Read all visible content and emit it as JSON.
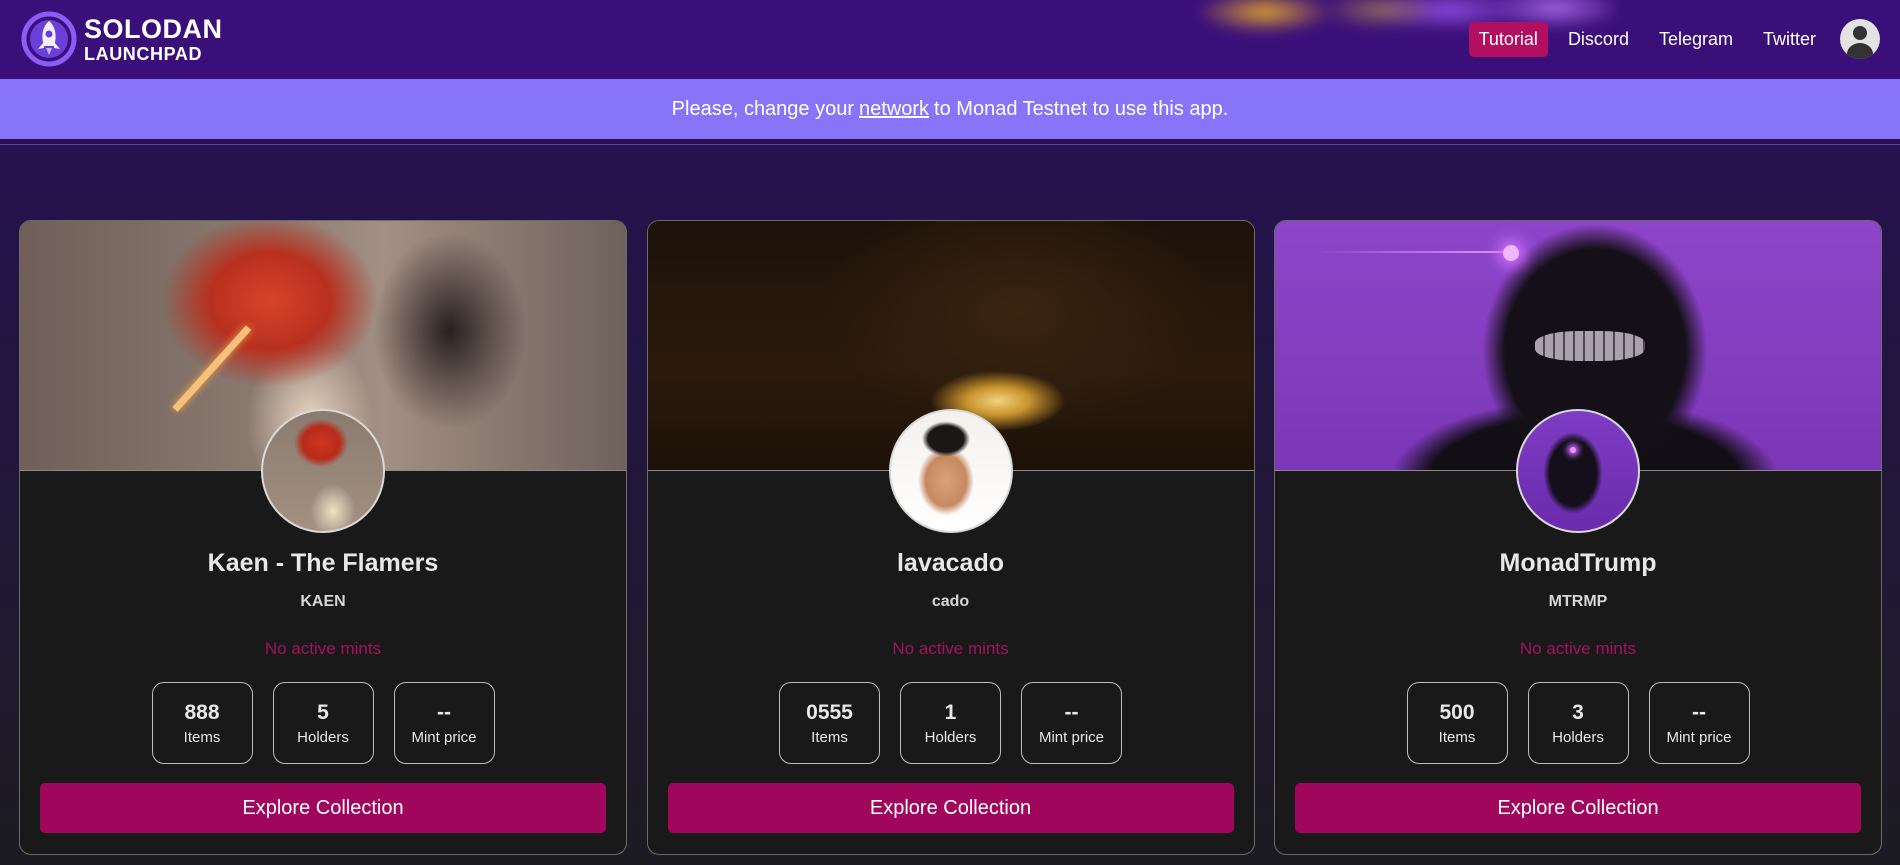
{
  "brand": {
    "line1": "SOLODAN",
    "line2": "LAUNCHPAD"
  },
  "nav": {
    "tutorial": "Tutorial",
    "discord": "Discord",
    "telegram": "Telegram",
    "twitter": "Twitter"
  },
  "banner": {
    "before": "Please, change your",
    "link": "network",
    "after": "to Monad Testnet to use this app."
  },
  "colors": {
    "topbar": "#3b0f7a",
    "banner": "#8874f8",
    "accent": "#a0065c",
    "status": "#a3125d"
  },
  "collections": [
    {
      "title": "Kaen - The Flamers",
      "symbol": "KAEN",
      "status": "No active mints",
      "items_value": "888",
      "items_label": "Items",
      "holders_value": "5",
      "holders_label": "Holders",
      "price_value": "--",
      "price_label": "Mint price",
      "cta": "Explore Collection"
    },
    {
      "title": "lavacado",
      "symbol": "cado",
      "status": "No active mints",
      "items_value": "0555",
      "items_label": "Items",
      "holders_value": "1",
      "holders_label": "Holders",
      "price_value": "--",
      "price_label": "Mint price",
      "cta": "Explore Collection"
    },
    {
      "title": "MonadTrump",
      "symbol": "MTRMP",
      "status": "No active mints",
      "items_value": "500",
      "items_label": "Items",
      "holders_value": "3",
      "holders_label": "Holders",
      "price_value": "--",
      "price_label": "Mint price",
      "cta": "Explore Collection"
    }
  ]
}
